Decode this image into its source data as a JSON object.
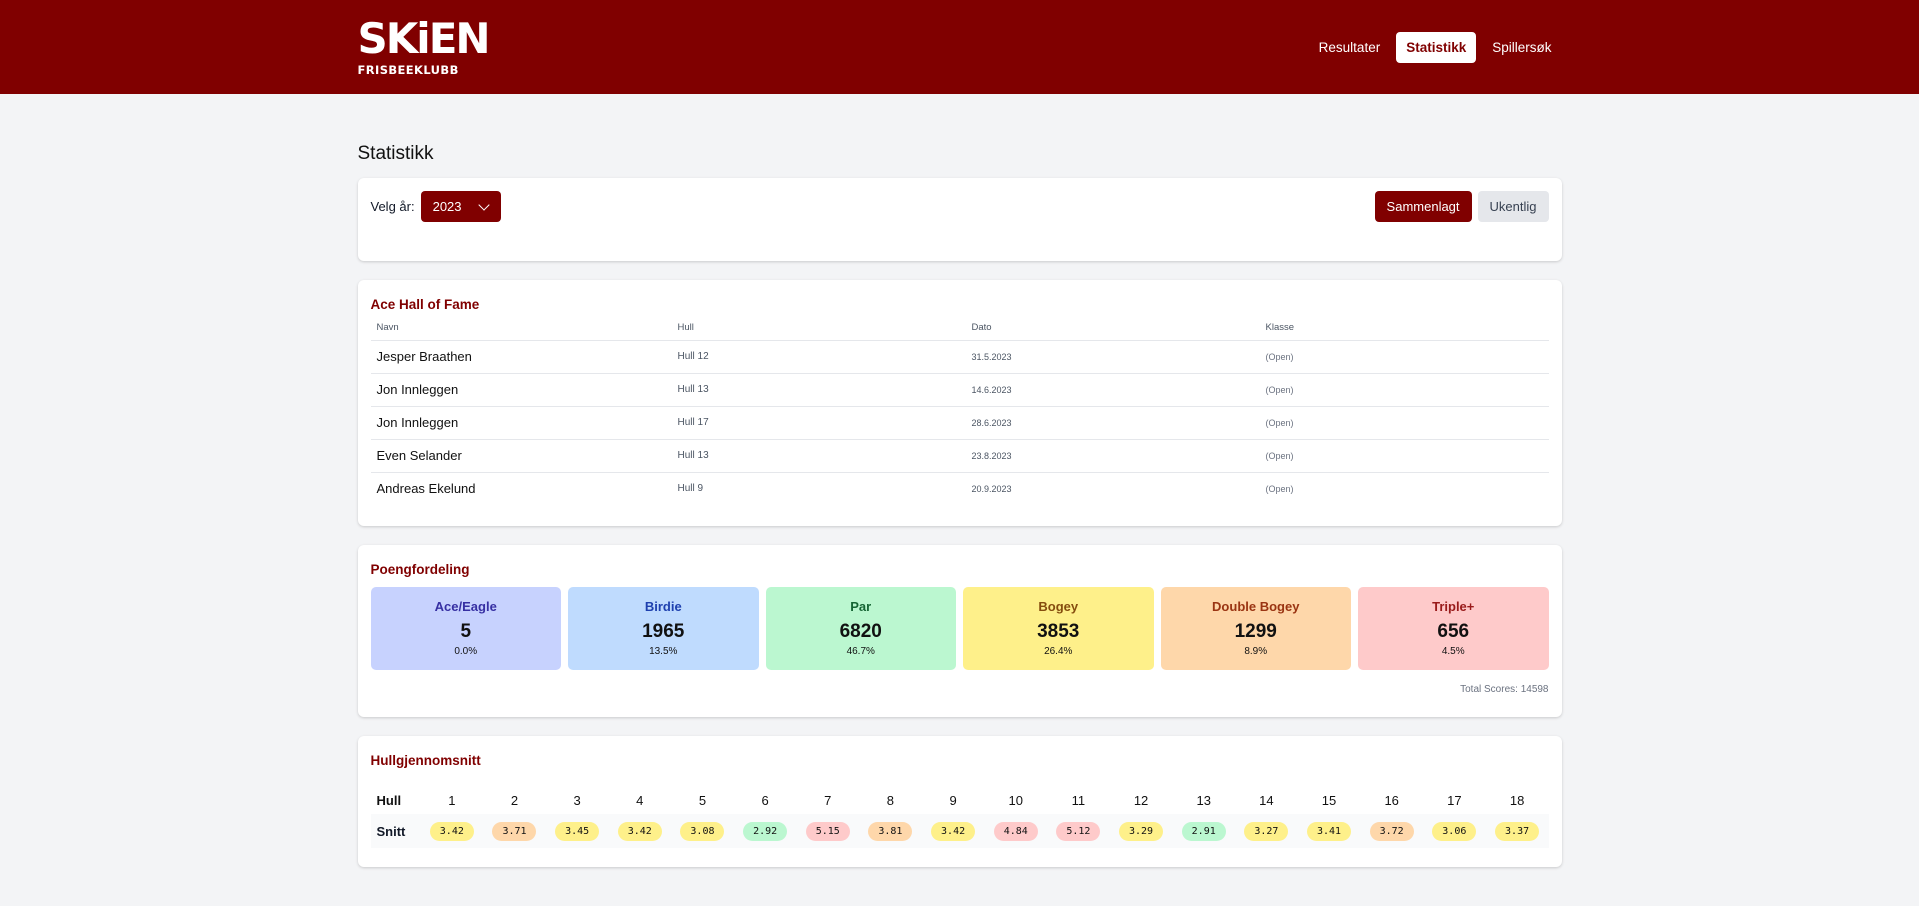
{
  "header": {
    "logo_main": "SKiEN",
    "logo_sub": "FRISBEEKLUBB",
    "nav": [
      {
        "label": "Resultater",
        "active": false
      },
      {
        "label": "Statistikk",
        "active": true
      },
      {
        "label": "Spillersøk",
        "active": false
      }
    ]
  },
  "page_title": "Statistikk",
  "filter": {
    "year_label": "Velg år:",
    "year_value": "2023",
    "mode_buttons": [
      {
        "label": "Sammenlagt",
        "active": true
      },
      {
        "label": "Ukentlig",
        "active": false
      }
    ]
  },
  "ace_hall_of_fame": {
    "title": "Ace Hall of Fame",
    "columns": [
      "Navn",
      "Hull",
      "Dato",
      "Klasse"
    ],
    "rows": [
      {
        "name": "Jesper Braathen",
        "hull": "Hull 12",
        "date": "31.5.2023",
        "class": "(Open)"
      },
      {
        "name": "Jon Innleggen",
        "hull": "Hull 13",
        "date": "14.6.2023",
        "class": "(Open)"
      },
      {
        "name": "Jon Innleggen",
        "hull": "Hull 17",
        "date": "28.6.2023",
        "class": "(Open)"
      },
      {
        "name": "Even Selander",
        "hull": "Hull 13",
        "date": "23.8.2023",
        "class": "(Open)"
      },
      {
        "name": "Andreas Ekelund",
        "hull": "Hull 9",
        "date": "20.9.2023",
        "class": "(Open)"
      }
    ]
  },
  "score_distribution": {
    "title": "Poengfordeling",
    "items": [
      {
        "label": "Ace/Eagle",
        "count": "5",
        "pct": "0.0%",
        "bg": "#c7d2fe",
        "fg": "#3730a3"
      },
      {
        "label": "Birdie",
        "count": "1965",
        "pct": "13.5%",
        "bg": "#bfdbfe",
        "fg": "#1e40af"
      },
      {
        "label": "Par",
        "count": "6820",
        "pct": "46.7%",
        "bg": "#bbf7d0",
        "fg": "#166534"
      },
      {
        "label": "Bogey",
        "count": "3853",
        "pct": "26.4%",
        "bg": "#fef08a",
        "fg": "#854d0e"
      },
      {
        "label": "Double Bogey",
        "count": "1299",
        "pct": "8.9%",
        "bg": "#fed7aa",
        "fg": "#9a3412"
      },
      {
        "label": "Triple+",
        "count": "656",
        "pct": "4.5%",
        "bg": "#fecaca",
        "fg": "#991b1b"
      }
    ],
    "total": "Total Scores: 14598"
  },
  "hole_averages": {
    "title": "Hullgjennomsnitt",
    "row_head_hole": "Hull",
    "row_head_avg": "Snitt",
    "holes": [
      {
        "hole": "1",
        "avg": "3.42",
        "color": "#fef08a"
      },
      {
        "hole": "2",
        "avg": "3.71",
        "color": "#fed7aa"
      },
      {
        "hole": "3",
        "avg": "3.45",
        "color": "#fef08a"
      },
      {
        "hole": "4",
        "avg": "3.42",
        "color": "#fef08a"
      },
      {
        "hole": "5",
        "avg": "3.08",
        "color": "#fef08a"
      },
      {
        "hole": "6",
        "avg": "2.92",
        "color": "#bbf7d0"
      },
      {
        "hole": "7",
        "avg": "5.15",
        "color": "#fecaca"
      },
      {
        "hole": "8",
        "avg": "3.81",
        "color": "#fed7aa"
      },
      {
        "hole": "9",
        "avg": "3.42",
        "color": "#fef08a"
      },
      {
        "hole": "10",
        "avg": "4.84",
        "color": "#fecaca"
      },
      {
        "hole": "11",
        "avg": "5.12",
        "color": "#fecaca"
      },
      {
        "hole": "12",
        "avg": "3.29",
        "color": "#fef08a"
      },
      {
        "hole": "13",
        "avg": "2.91",
        "color": "#bbf7d0"
      },
      {
        "hole": "14",
        "avg": "3.27",
        "color": "#fef08a"
      },
      {
        "hole": "15",
        "avg": "3.41",
        "color": "#fef08a"
      },
      {
        "hole": "16",
        "avg": "3.72",
        "color": "#fed7aa"
      },
      {
        "hole": "17",
        "avg": "3.06",
        "color": "#fef08a"
      },
      {
        "hole": "18",
        "avg": "3.37",
        "color": "#fef08a"
      }
    ]
  }
}
